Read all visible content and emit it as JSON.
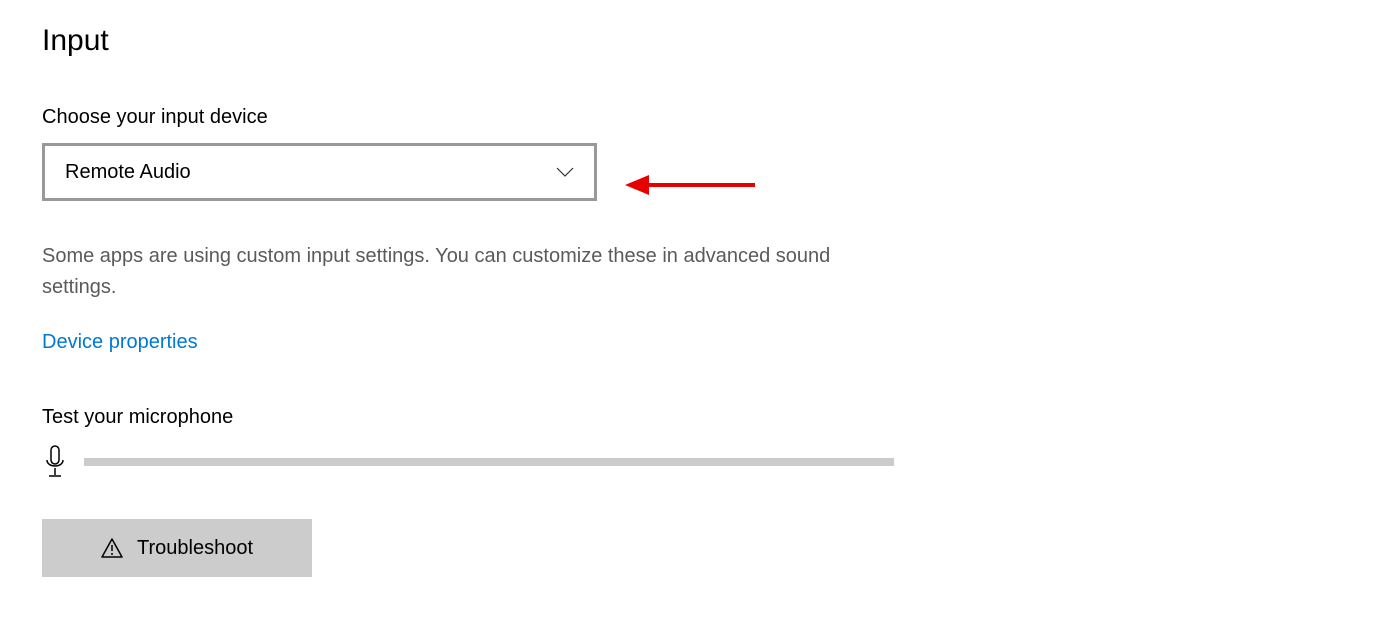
{
  "section": {
    "title": "Input"
  },
  "input_device": {
    "label": "Choose your input device",
    "selected": "Remote Audio"
  },
  "description": "Some apps are using custom input settings. You can customize these in advanced sound settings.",
  "link_label": "Device properties",
  "test": {
    "label": "Test your microphone"
  },
  "troubleshoot": {
    "label": "Troubleshoot"
  }
}
